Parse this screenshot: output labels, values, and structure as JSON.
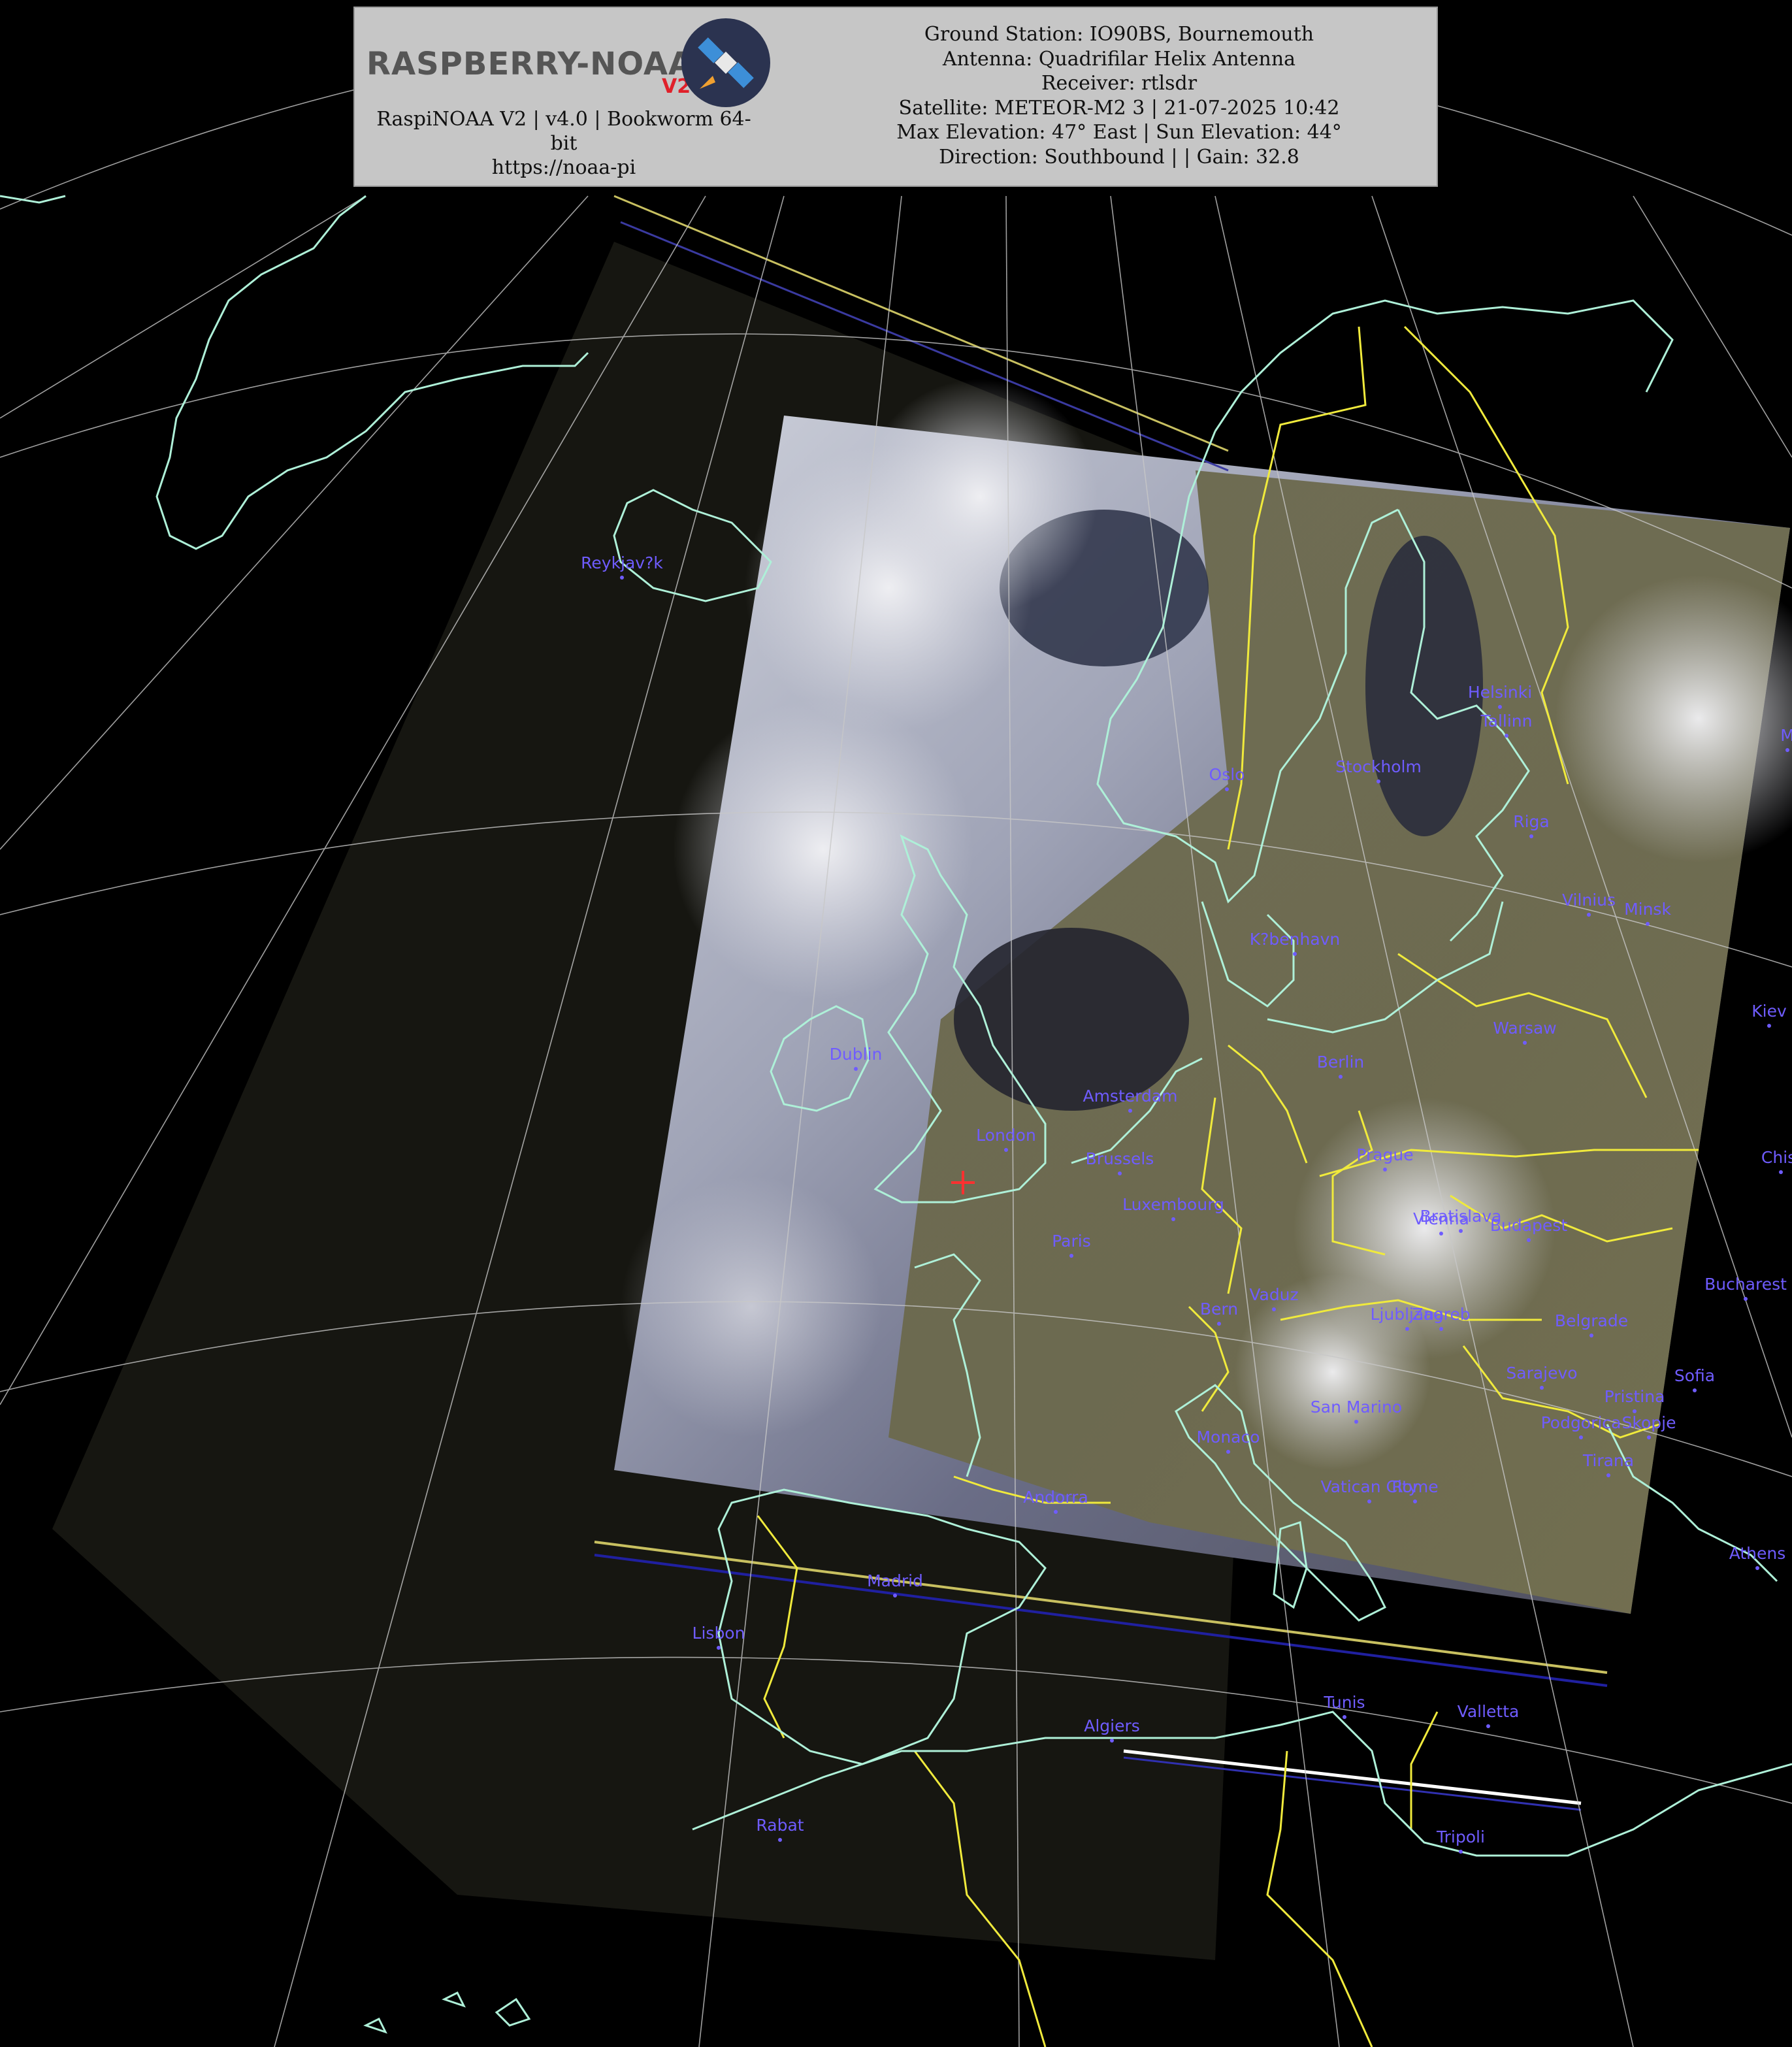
{
  "header": {
    "logo_text": "RASPBERRY-NOAA",
    "logo_version": "V2",
    "left_lines": [
      "RaspiNOAA V2 | v4.0 | Bookworm 64-",
      "bit",
      "https://noaa-pi"
    ],
    "right_lines": [
      "Ground Station: IO90BS, Bournemouth",
      "Antenna: Quadrifilar Helix Antenna",
      "Receiver: rtlsdr",
      "Satellite: METEOR-M2 3 | 21-07-2025 10:42",
      "Max Elevation: 47° East | Sun Elevation: 44°",
      "Direction: Southbound | | Gain: 32.8"
    ]
  },
  "icons": {
    "logo": "satellite-icon",
    "station_marker": "crosshair-icon"
  },
  "colors": {
    "coastline": "#aef0d8",
    "border": "#f0ea3c",
    "graticule": "#c8c8c8",
    "city_label": "#6f5cff",
    "station_marker": "#ff3030"
  },
  "cities": [
    {
      "name": "Reykjav?k"
    },
    {
      "name": "Helsinki"
    },
    {
      "name": "Tallinn"
    },
    {
      "name": "Oslo"
    },
    {
      "name": "Stockholm"
    },
    {
      "name": "Riga"
    },
    {
      "name": "Vilnius"
    },
    {
      "name": "Minsk"
    },
    {
      "name": "K?benhavn"
    },
    {
      "name": "Kiev"
    },
    {
      "name": "Dublin"
    },
    {
      "name": "Warsaw"
    },
    {
      "name": "Berlin"
    },
    {
      "name": "Amsterdam"
    },
    {
      "name": "London"
    },
    {
      "name": "Brussels"
    },
    {
      "name": "Prague"
    },
    {
      "name": "Chisi"
    },
    {
      "name": "Luxembourg"
    },
    {
      "name": "Bratislava"
    },
    {
      "name": "Vienna"
    },
    {
      "name": "Budapest"
    },
    {
      "name": "Paris"
    },
    {
      "name": "Bucharest"
    },
    {
      "name": "Bern"
    },
    {
      "name": "Vaduz"
    },
    {
      "name": "Ljubljana"
    },
    {
      "name": "Zagreb"
    },
    {
      "name": "Belgrade"
    },
    {
      "name": "Sarajevo"
    },
    {
      "name": "Sofia"
    },
    {
      "name": "Pristina"
    },
    {
      "name": "San Marino"
    },
    {
      "name": "Podgorica"
    },
    {
      "name": "Skopje"
    },
    {
      "name": "Monaco"
    },
    {
      "name": "Tirana"
    },
    {
      "name": "Andorra"
    },
    {
      "name": "Vatican City"
    },
    {
      "name": "Rome"
    },
    {
      "name": "Athens"
    },
    {
      "name": "Madrid"
    },
    {
      "name": "Lisbon"
    },
    {
      "name": "Tunis"
    },
    {
      "name": "Valletta"
    },
    {
      "name": "Algiers"
    },
    {
      "name": "Rabat"
    },
    {
      "name": "Tripoli"
    },
    {
      "name": "M"
    }
  ]
}
